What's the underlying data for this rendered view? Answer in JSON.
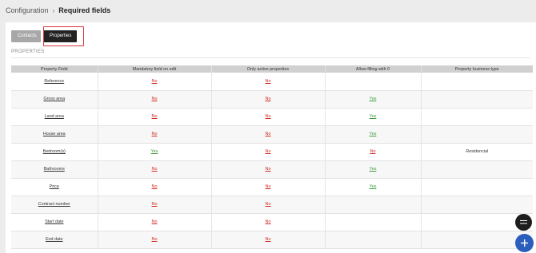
{
  "breadcrumb": {
    "parent": "Configuration",
    "separator": "›",
    "current": "Required fields"
  },
  "tabs": [
    {
      "label": "Contacts",
      "active": false
    },
    {
      "label": "Properties",
      "active": true
    }
  ],
  "section": {
    "title": "PROPERTIES"
  },
  "table": {
    "columns": [
      "Property Field",
      "Mandatory field on edit",
      "Only active properties",
      "Allow filling with 0",
      "Property business type"
    ],
    "rows": [
      {
        "field": "Reference",
        "mandatory": "No",
        "active_only": "No",
        "allow_zero": "",
        "business_type": ""
      },
      {
        "field": "Gross area",
        "mandatory": "No",
        "active_only": "No",
        "allow_zero": "Yes",
        "business_type": ""
      },
      {
        "field": "Land area",
        "mandatory": "No",
        "active_only": "No",
        "allow_zero": "Yes",
        "business_type": ""
      },
      {
        "field": "House area",
        "mandatory": "No",
        "active_only": "No",
        "allow_zero": "Yes",
        "business_type": ""
      },
      {
        "field": "Bedroom(s)",
        "mandatory": "Yes",
        "active_only": "No",
        "allow_zero": "No",
        "business_type": "Residencial"
      },
      {
        "field": "Bathrooms",
        "mandatory": "No",
        "active_only": "No",
        "allow_zero": "Yes",
        "business_type": ""
      },
      {
        "field": "Price",
        "mandatory": "No",
        "active_only": "No",
        "allow_zero": "Yes",
        "business_type": ""
      },
      {
        "field": "Contract number",
        "mandatory": "No",
        "active_only": "No",
        "allow_zero": "",
        "business_type": ""
      },
      {
        "field": "Start date",
        "mandatory": "No",
        "active_only": "No",
        "allow_zero": "",
        "business_type": ""
      },
      {
        "field": "End date",
        "mandatory": "No",
        "active_only": "No",
        "allow_zero": "",
        "business_type": ""
      }
    ]
  },
  "fabs": {
    "menu_icon": "menu-icon",
    "add_icon": "plus-icon"
  },
  "colors": {
    "no": "#d0261d",
    "yes": "#3d9a3d",
    "active_tab": "#222222",
    "highlight": "#d9353a",
    "add_button": "#2b5dbd"
  }
}
